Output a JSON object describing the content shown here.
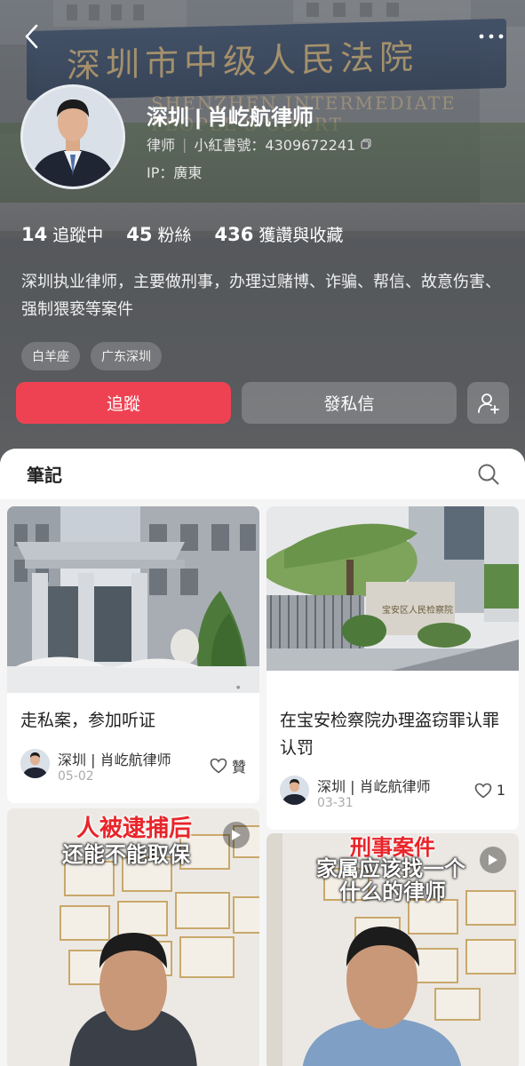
{
  "header": {
    "background_sign_text": "深圳市中级人民法院",
    "background_sign_subtext": "SHENZHEN INTERMEDIATE PEOPLE'S COURT",
    "profile": {
      "name": "深圳 | 肖屹航律师",
      "role": "律师",
      "id_label": "小紅書號：4309672241",
      "ip": "IP：廣東"
    },
    "stats": [
      {
        "num": "14",
        "label": "追蹤中"
      },
      {
        "num": "45",
        "label": "粉絲"
      },
      {
        "num": "436",
        "label": "獲讚與收藏"
      }
    ],
    "bio": "深圳执业律师，主要做刑事，办理过赌博、诈骗、帮信、故意伤害、强制猥亵等案件",
    "tags": [
      "白羊座",
      "广东深圳"
    ],
    "buttons": {
      "follow": "追蹤",
      "message": "發私信"
    }
  },
  "notes": {
    "tab_title": "筆記",
    "cards": [
      {
        "title": "走私案，参加听证",
        "author": "深圳 | 肖屹航律师",
        "date": "05-02",
        "likes": "贊",
        "img_overlay_red": "",
        "img_overlay_white": ""
      },
      {
        "title": "在宝安检察院办理盗窃罪认罪认罚",
        "author": "深圳 | 肖屹航律师",
        "date": "03-31",
        "likes": "1",
        "img_sign": "宝安区人民检察院",
        "img_overlay_red": "",
        "img_overlay_white": ""
      },
      {
        "title": "",
        "img_overlay_red": "人被逮捕后",
        "img_overlay_white": "还能不能取保"
      },
      {
        "title": "",
        "img_overlay_red": "刑事案件",
        "img_overlay_white": "家属应该找一个什么的律师",
        "img_overlay_white_line1": "家属应该找一个",
        "img_overlay_white_line2": "什么的律师"
      }
    ]
  },
  "colors": {
    "accent_red": "#ee4253",
    "header_bg": "#5d6166"
  }
}
